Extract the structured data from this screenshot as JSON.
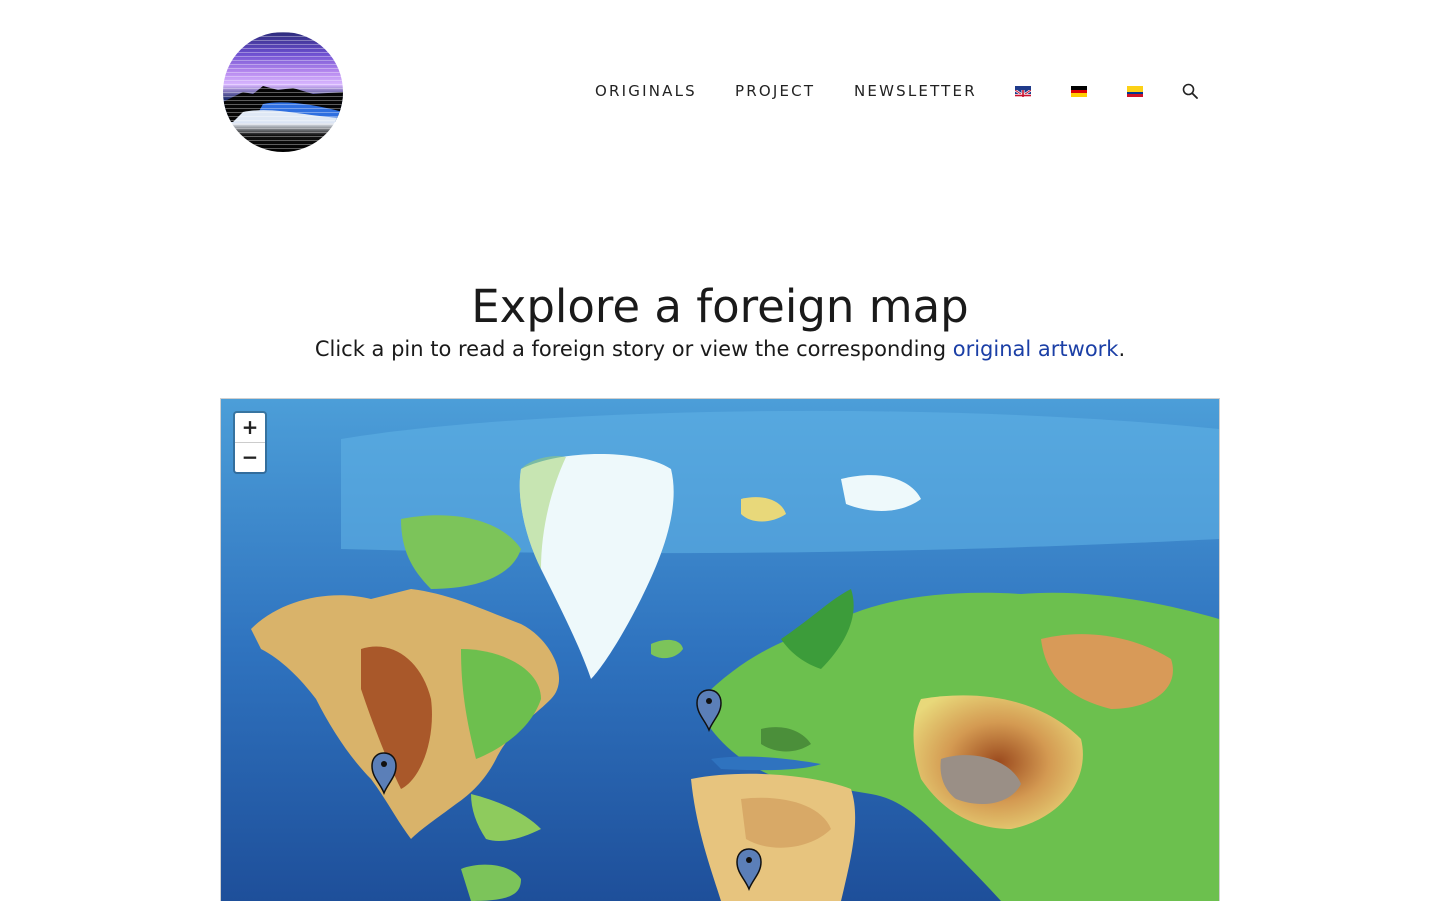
{
  "header": {
    "logo_alt": "Foreign Originals logo",
    "nav": [
      {
        "label": "ORIGINALS"
      },
      {
        "label": "PROJECT"
      },
      {
        "label": "NEWSLETTER"
      }
    ],
    "languages": [
      {
        "code": "en",
        "icon": "flag-gb-icon"
      },
      {
        "code": "de",
        "icon": "flag-de-icon"
      },
      {
        "code": "co",
        "icon": "flag-co-icon"
      }
    ],
    "search_icon": "search-icon"
  },
  "hero": {
    "title": "Explore a foreign map",
    "subtitle_before": "Click a pin to read a foreign story or view the corresponding ",
    "subtitle_link": "original artwork",
    "subtitle_after": "."
  },
  "map": {
    "zoom_in": "+",
    "zoom_out": "−",
    "pins": [
      {
        "name": "map-pin-california"
      },
      {
        "name": "map-pin-england"
      },
      {
        "name": "map-pin-central-africa"
      }
    ]
  },
  "colors": {
    "link": "#1b3fa6",
    "pin_fill": "#5b7fb8",
    "ocean": "#2a6fb8"
  }
}
